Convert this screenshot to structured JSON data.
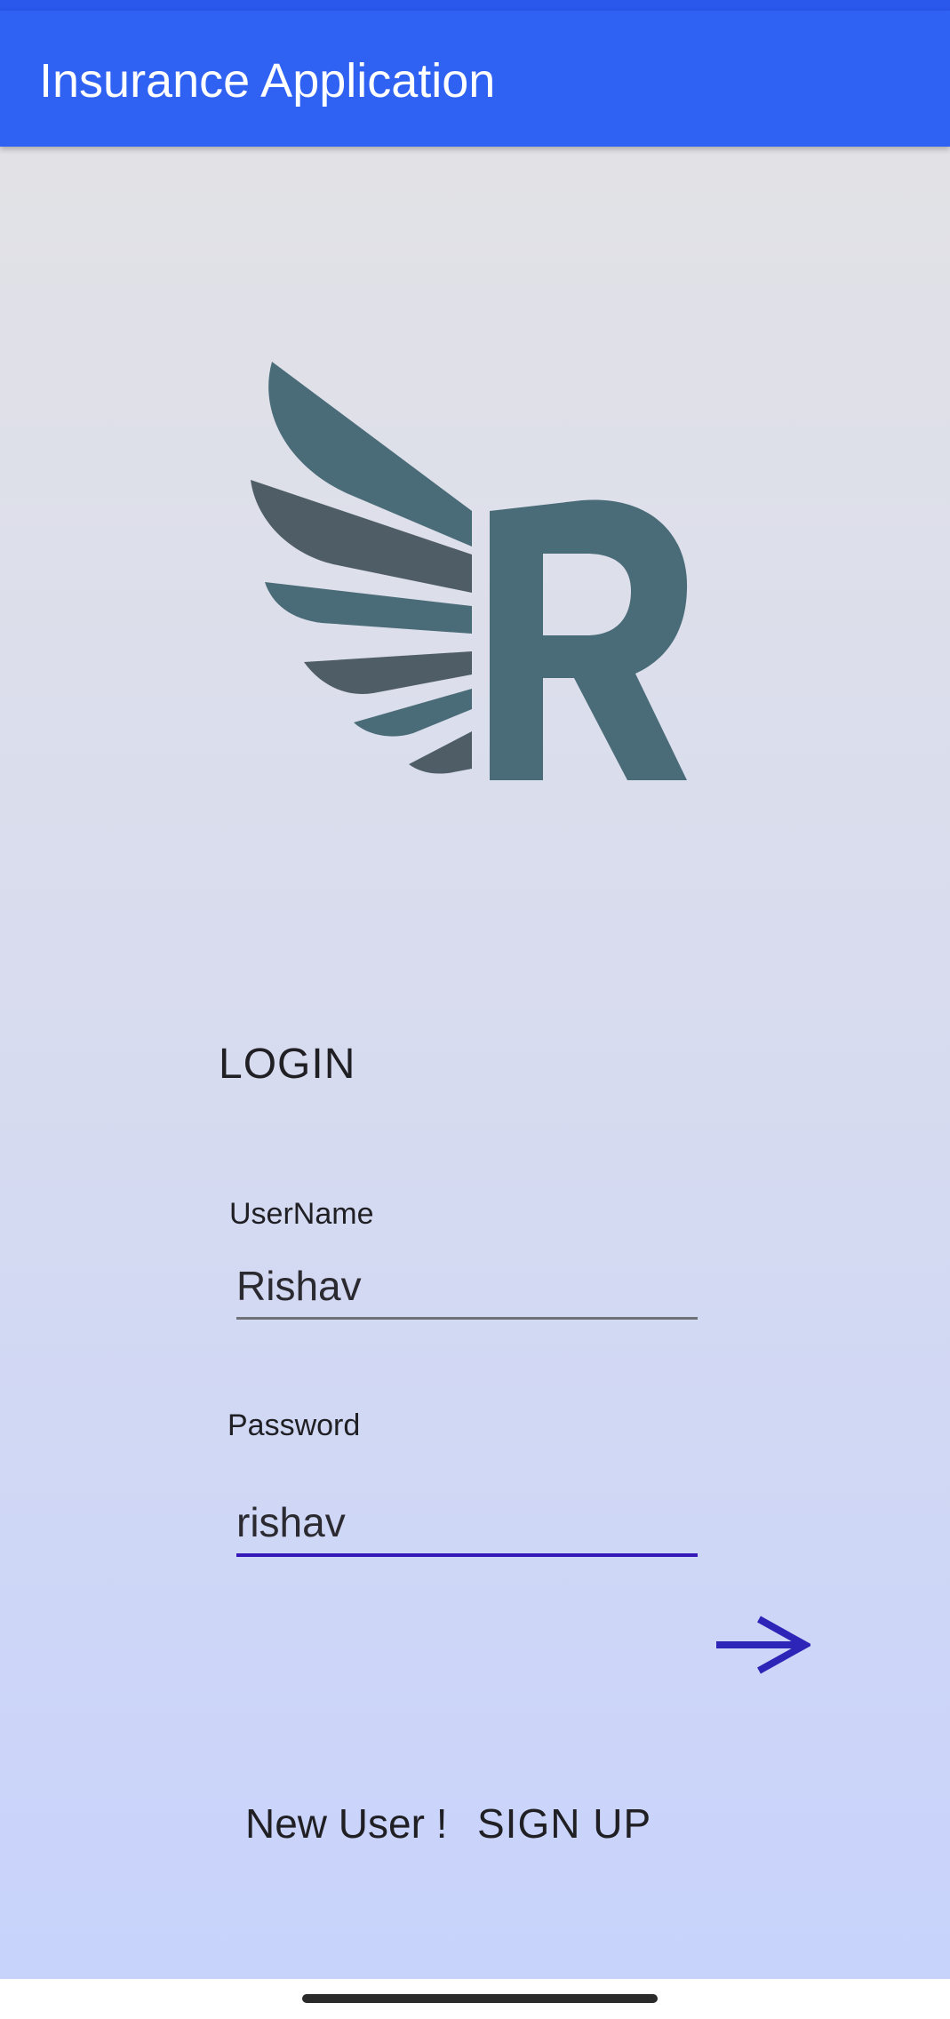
{
  "app_bar": {
    "title": "Insurance Application"
  },
  "logo": {
    "icon": "winged-r-logo",
    "colors": {
      "teal": "#4a6b78",
      "slate": "#4f5d67"
    }
  },
  "login": {
    "heading": "LOGIN",
    "username": {
      "label": "UserName",
      "value": "Rishav"
    },
    "password": {
      "label": "Password",
      "value": "rishav"
    },
    "submit_icon": "arrow-right-icon"
  },
  "footer": {
    "new_user_text": "New User !",
    "signup_label": "SIGN UP"
  },
  "theme": {
    "primary": "#2f62f2",
    "accent": "#3418b8",
    "arrow": "#2d24b8"
  }
}
